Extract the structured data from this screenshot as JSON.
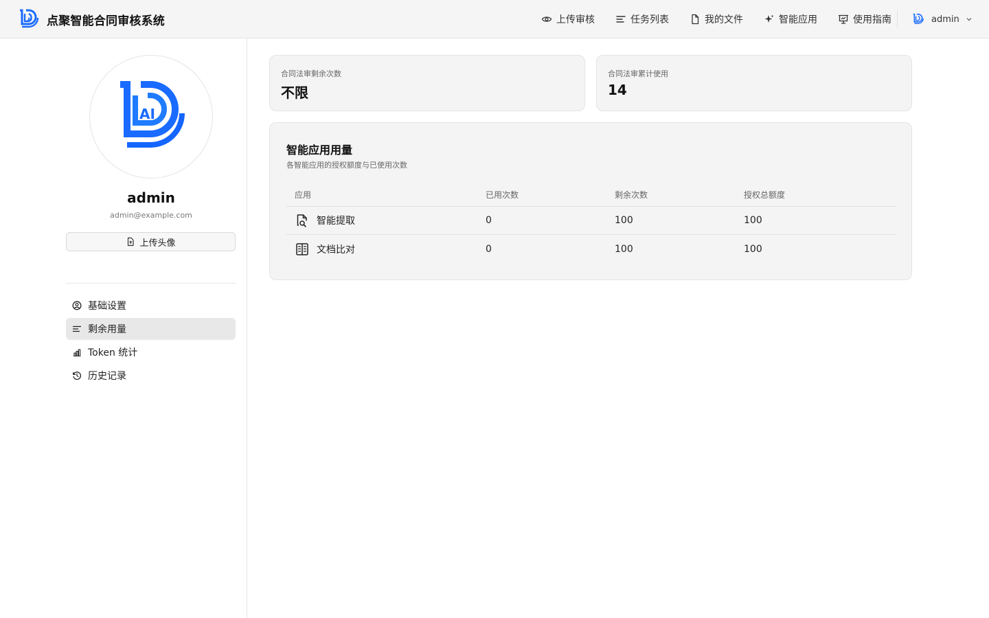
{
  "header": {
    "brand_title": "点聚智能合同审核系统",
    "nav": [
      {
        "label": "上传审核",
        "icon": "eye-icon"
      },
      {
        "label": "任务列表",
        "icon": "list-icon"
      },
      {
        "label": "我的文件",
        "icon": "file-icon"
      },
      {
        "label": "智能应用",
        "icon": "sparkle-icon"
      },
      {
        "label": "使用指南",
        "icon": "presentation-icon"
      }
    ],
    "user": {
      "name": "admin",
      "icon": "brand-logo-icon"
    }
  },
  "sidebar": {
    "name": "admin",
    "email": "admin@example.com",
    "upload_label": "上传头像",
    "menu": [
      {
        "label": "基础设置",
        "icon": "user-circle-icon",
        "active": false
      },
      {
        "label": "剩余用量",
        "icon": "list-icon",
        "active": true
      },
      {
        "label": "Token 统计",
        "icon": "bar-chart-icon",
        "active": false
      },
      {
        "label": "历史记录",
        "icon": "history-icon",
        "active": false
      }
    ]
  },
  "stats": [
    {
      "label": "合同法审剩余次数",
      "value": "不限"
    },
    {
      "label": "合同法审累计使用",
      "value": "14"
    }
  ],
  "usage": {
    "title": "智能应用用量",
    "subtitle": "各智能应用的授权额度与已使用次数",
    "columns": [
      "应用",
      "已用次数",
      "剩余次数",
      "授权总额度"
    ],
    "rows": [
      {
        "app": "智能提取",
        "icon": "file-search-icon",
        "used": "0",
        "remaining": "100",
        "total": "100"
      },
      {
        "app": "文档比对",
        "icon": "compare-icon",
        "used": "0",
        "remaining": "100",
        "total": "100"
      }
    ]
  },
  "colors": {
    "brand_blue": "#1a6bff",
    "active_bg": "#e8e8e8",
    "card_bg": "#f4f4f4"
  }
}
